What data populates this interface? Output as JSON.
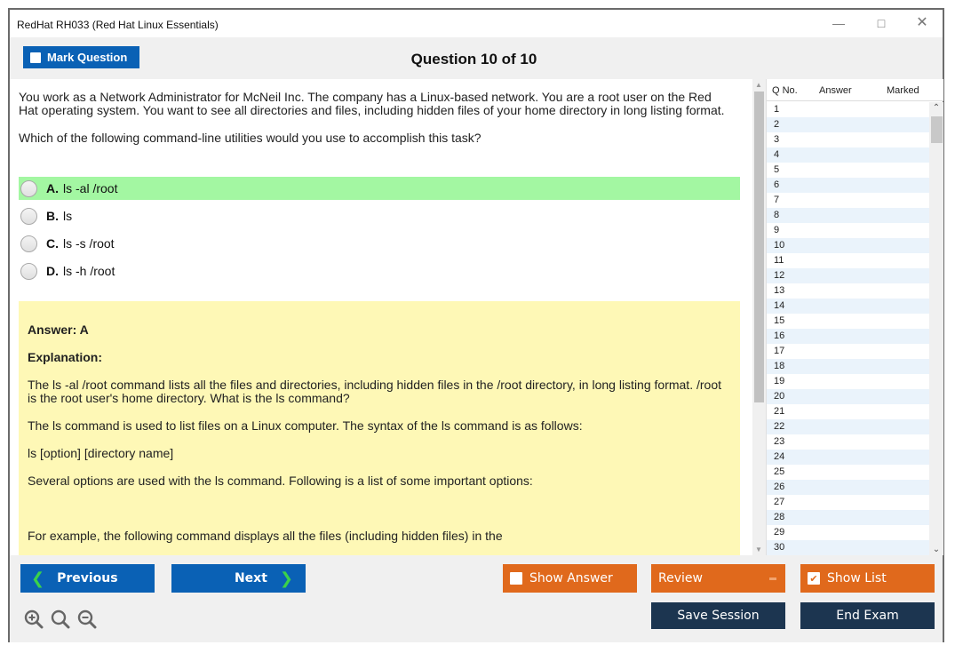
{
  "window": {
    "title": "RedHat RH033 (Red Hat Linux Essentials)",
    "controls": {
      "minimize": "—",
      "maximize": "□",
      "close": "✕"
    }
  },
  "toolbar": {
    "mark_question_label": "Mark Question",
    "question_counter": "Question 10 of 10"
  },
  "question": {
    "paragraphs": [
      "You work as a Network Administrator for McNeil Inc. The company has a Linux-based network. You are a root user on the Red Hat operating system. You want to see all directories and files, including hidden files of your home directory in long listing format.",
      "Which of the following command-line utilities would you use to accomplish this task?"
    ],
    "options": [
      {
        "letter": "A.",
        "text": "ls -al /root",
        "correct": true
      },
      {
        "letter": "B.",
        "text": "ls",
        "correct": false
      },
      {
        "letter": "C.",
        "text": "ls -s /root",
        "correct": false
      },
      {
        "letter": "D.",
        "text": "ls -h /root",
        "correct": false
      }
    ]
  },
  "answer": {
    "answer_line": "Answer: A",
    "explanation_heading": "Explanation:",
    "paragraphs": [
      "The ls -al /root command lists all the files and directories, including hidden files in the /root directory, in long listing format. /root is the root user's home directory. What is the ls command?",
      "The ls command is used to list files on a Linux computer. The syntax of the ls command is as follows:",
      "ls [option] [directory name]",
      "Several options are used with the ls command. Following is a list of some important options:"
    ],
    "after_gap": "For example, the following command displays all the files (including hidden files) in the"
  },
  "question_list": {
    "headers": {
      "qno": "Q No.",
      "answer": "Answer",
      "marked": "Marked"
    },
    "rows": [
      "1",
      "2",
      "3",
      "4",
      "5",
      "6",
      "7",
      "8",
      "9",
      "10",
      "11",
      "12",
      "13",
      "14",
      "15",
      "16",
      "17",
      "18",
      "19",
      "20",
      "21",
      "22",
      "23",
      "24",
      "25",
      "26",
      "27",
      "28",
      "29",
      "30"
    ]
  },
  "bottom": {
    "previous_label": "Previous",
    "next_label": "Next",
    "show_answer_label": "Show Answer",
    "show_answer_checked": false,
    "review_label": "Review",
    "show_list_label": "Show List",
    "show_list_checked": true,
    "save_session_label": "Save Session",
    "end_exam_label": "End Exam",
    "zoom_icons": [
      "zoom-in-icon",
      "zoom-reset-icon",
      "zoom-out-icon"
    ]
  },
  "colors": {
    "primary_blue": "#0a61b5",
    "orange": "#e0691c",
    "dark_navy": "#1c3550",
    "correct_green": "#a3f7a2",
    "answer_yellow": "#fef8b6",
    "chevron_green": "#3bd24a"
  }
}
